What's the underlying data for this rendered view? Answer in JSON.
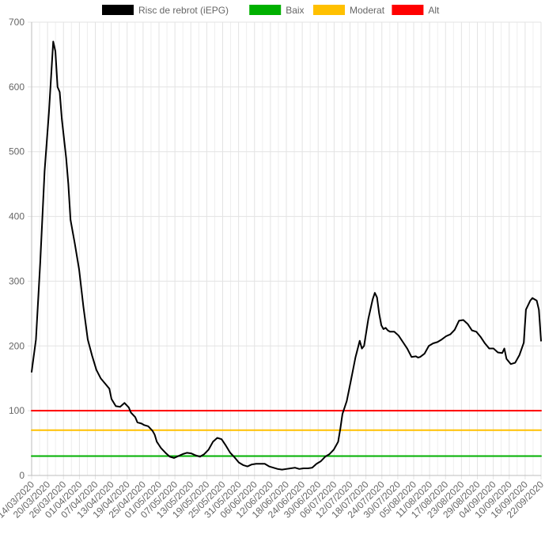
{
  "chart_data": {
    "type": "line",
    "title": "",
    "xlabel": "",
    "ylabel": "",
    "ylim": [
      0,
      700
    ],
    "y_ticks": [
      0,
      100,
      200,
      300,
      400,
      500,
      600,
      700
    ],
    "grid": true,
    "legend_position": "top-center",
    "x_tick_labels": [
      "14/03/2020",
      "20/03/2020",
      "26/03/2020",
      "01/04/2020",
      "07/04/2020",
      "13/04/2020",
      "19/04/2020",
      "25/04/2020",
      "01/05/2020",
      "07/05/2020",
      "13/05/2020",
      "19/05/2020",
      "25/05/2020",
      "31/05/2020",
      "06/06/2020",
      "12/06/2020",
      "18/06/2020",
      "24/06/2020",
      "30/06/2020",
      "06/07/2020",
      "12/07/2020",
      "18/07/2020",
      "24/07/2020",
      "30/07/2020",
      "05/08/2020",
      "11/08/2020",
      "17/08/2020",
      "23/08/2020",
      "29/08/2020",
      "04/09/2020",
      "10/09/2020",
      "16/09/2020",
      "22/09/2020"
    ],
    "series": [
      {
        "name": "Risc de rebrot (iEPG)",
        "color": "#000000",
        "values": [
          [
            0,
            160
          ],
          [
            2,
            210
          ],
          [
            4,
            330
          ],
          [
            6,
            470
          ],
          [
            8,
            560
          ],
          [
            10,
            670
          ],
          [
            11,
            655
          ],
          [
            12,
            600
          ],
          [
            13,
            592
          ],
          [
            14,
            550
          ],
          [
            16,
            490
          ],
          [
            17,
            450
          ],
          [
            18,
            395
          ],
          [
            20,
            358
          ],
          [
            22,
            318
          ],
          [
            24,
            260
          ],
          [
            26,
            210
          ],
          [
            28,
            185
          ],
          [
            30,
            163
          ],
          [
            32,
            150
          ],
          [
            34,
            142
          ],
          [
            36,
            134
          ],
          [
            37,
            118
          ],
          [
            39,
            107
          ],
          [
            41,
            106
          ],
          [
            43,
            112
          ],
          [
            45,
            105
          ],
          [
            46,
            97
          ],
          [
            48,
            90
          ],
          [
            49,
            82
          ],
          [
            51,
            80
          ],
          [
            52,
            78
          ],
          [
            54,
            76
          ],
          [
            56,
            69
          ],
          [
            57,
            63
          ],
          [
            58,
            52
          ],
          [
            60,
            42
          ],
          [
            62,
            35
          ],
          [
            64,
            29
          ],
          [
            66,
            27
          ],
          [
            68,
            30
          ],
          [
            70,
            33
          ],
          [
            72,
            35
          ],
          [
            74,
            34
          ],
          [
            76,
            31
          ],
          [
            78,
            29
          ],
          [
            80,
            33
          ],
          [
            82,
            40
          ],
          [
            84,
            52
          ],
          [
            86,
            58
          ],
          [
            88,
            56
          ],
          [
            90,
            46
          ],
          [
            92,
            35
          ],
          [
            94,
            28
          ],
          [
            96,
            20
          ],
          [
            98,
            16
          ],
          [
            100,
            14
          ],
          [
            102,
            17
          ],
          [
            104,
            18
          ],
          [
            106,
            18
          ],
          [
            108,
            18
          ],
          [
            110,
            14
          ],
          [
            112,
            12
          ],
          [
            114,
            10
          ],
          [
            116,
            9
          ],
          [
            118,
            10
          ],
          [
            120,
            11
          ],
          [
            122,
            12
          ],
          [
            124,
            10
          ],
          [
            126,
            11
          ],
          [
            128,
            11
          ],
          [
            130,
            12
          ],
          [
            132,
            18
          ],
          [
            134,
            22
          ],
          [
            136,
            29
          ],
          [
            138,
            33
          ],
          [
            140,
            40
          ],
          [
            142,
            52
          ],
          [
            143,
            72
          ],
          [
            144,
            95
          ],
          [
            146,
            115
          ],
          [
            148,
            148
          ],
          [
            150,
            182
          ],
          [
            152,
            208
          ],
          [
            153,
            196
          ],
          [
            154,
            200
          ],
          [
            156,
            242
          ],
          [
            158,
            272
          ],
          [
            159,
            282
          ],
          [
            160,
            275
          ],
          [
            161,
            250
          ],
          [
            162,
            232
          ],
          [
            163,
            226
          ],
          [
            164,
            228
          ],
          [
            165,
            224
          ],
          [
            166,
            222
          ],
          [
            168,
            222
          ],
          [
            170,
            216
          ],
          [
            172,
            206
          ],
          [
            174,
            196
          ],
          [
            176,
            183
          ],
          [
            178,
            184
          ],
          [
            179,
            182
          ],
          [
            180,
            183
          ],
          [
            182,
            188
          ],
          [
            184,
            200
          ],
          [
            186,
            204
          ],
          [
            188,
            206
          ],
          [
            190,
            210
          ],
          [
            192,
            215
          ],
          [
            194,
            218
          ],
          [
            196,
            225
          ],
          [
            198,
            239
          ],
          [
            200,
            240
          ],
          [
            202,
            234
          ],
          [
            204,
            224
          ],
          [
            206,
            222
          ],
          [
            208,
            214
          ],
          [
            210,
            204
          ],
          [
            212,
            196
          ],
          [
            214,
            196
          ],
          [
            216,
            190
          ],
          [
            218,
            189
          ],
          [
            219,
            196
          ],
          [
            220,
            180
          ],
          [
            222,
            172
          ],
          [
            224,
            174
          ],
          [
            226,
            186
          ],
          [
            228,
            205
          ],
          [
            229,
            256
          ],
          [
            231,
            270
          ],
          [
            232,
            274
          ],
          [
            233,
            272
          ],
          [
            234,
            270
          ],
          [
            235,
            256
          ],
          [
            236,
            208
          ]
        ]
      },
      {
        "name": "Baix",
        "color": "#00b000",
        "values": [
          [
            0,
            30
          ],
          [
            236,
            30
          ]
        ]
      },
      {
        "name": "Moderat",
        "color": "#ffc000",
        "values": [
          [
            0,
            70
          ],
          [
            236,
            70
          ]
        ]
      },
      {
        "name": "Alt",
        "color": "#ff0000",
        "values": [
          [
            0,
            100
          ],
          [
            236,
            100
          ]
        ]
      }
    ]
  }
}
